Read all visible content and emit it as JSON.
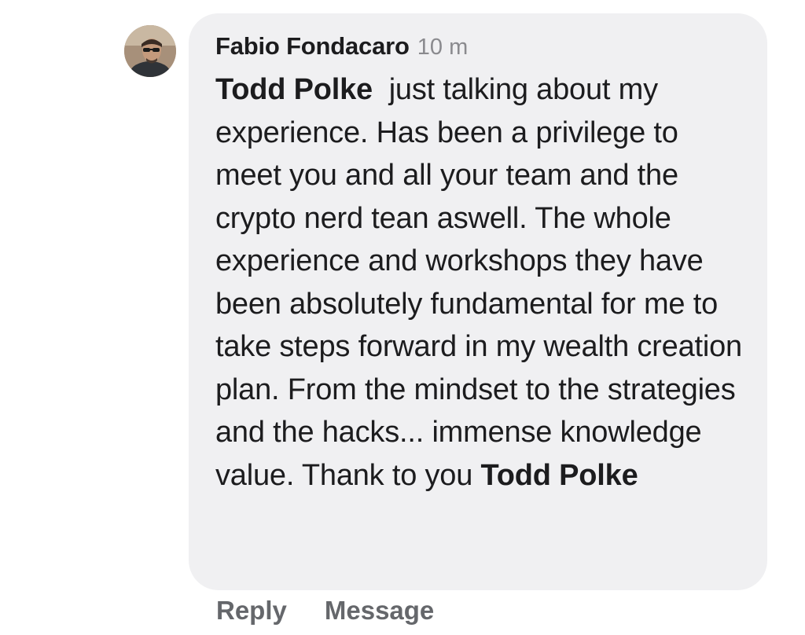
{
  "comment": {
    "author": "Fabio Fondacaro",
    "time": "10 m",
    "mention_start": "Todd Polke",
    "text_main": "just talking about my experience. Has been a privilege to meet you and all your team and the crypto nerd tean aswell. The whole experience and workshops they have been absolutely fundamental for me to take steps forward in my wealth creation plan. From the mindset to the strategies and the hacks... immense knowledge value. Thank to you",
    "mention_end": "Todd Polke"
  },
  "actions": {
    "reply_label": "Reply",
    "message_label": "Message"
  },
  "colors": {
    "bubble_bg": "#f0f0f2",
    "text": "#1c1c1e",
    "muted": "#8a8a8e",
    "action": "#65676b"
  },
  "icons": {
    "avatar": "profile-photo"
  }
}
